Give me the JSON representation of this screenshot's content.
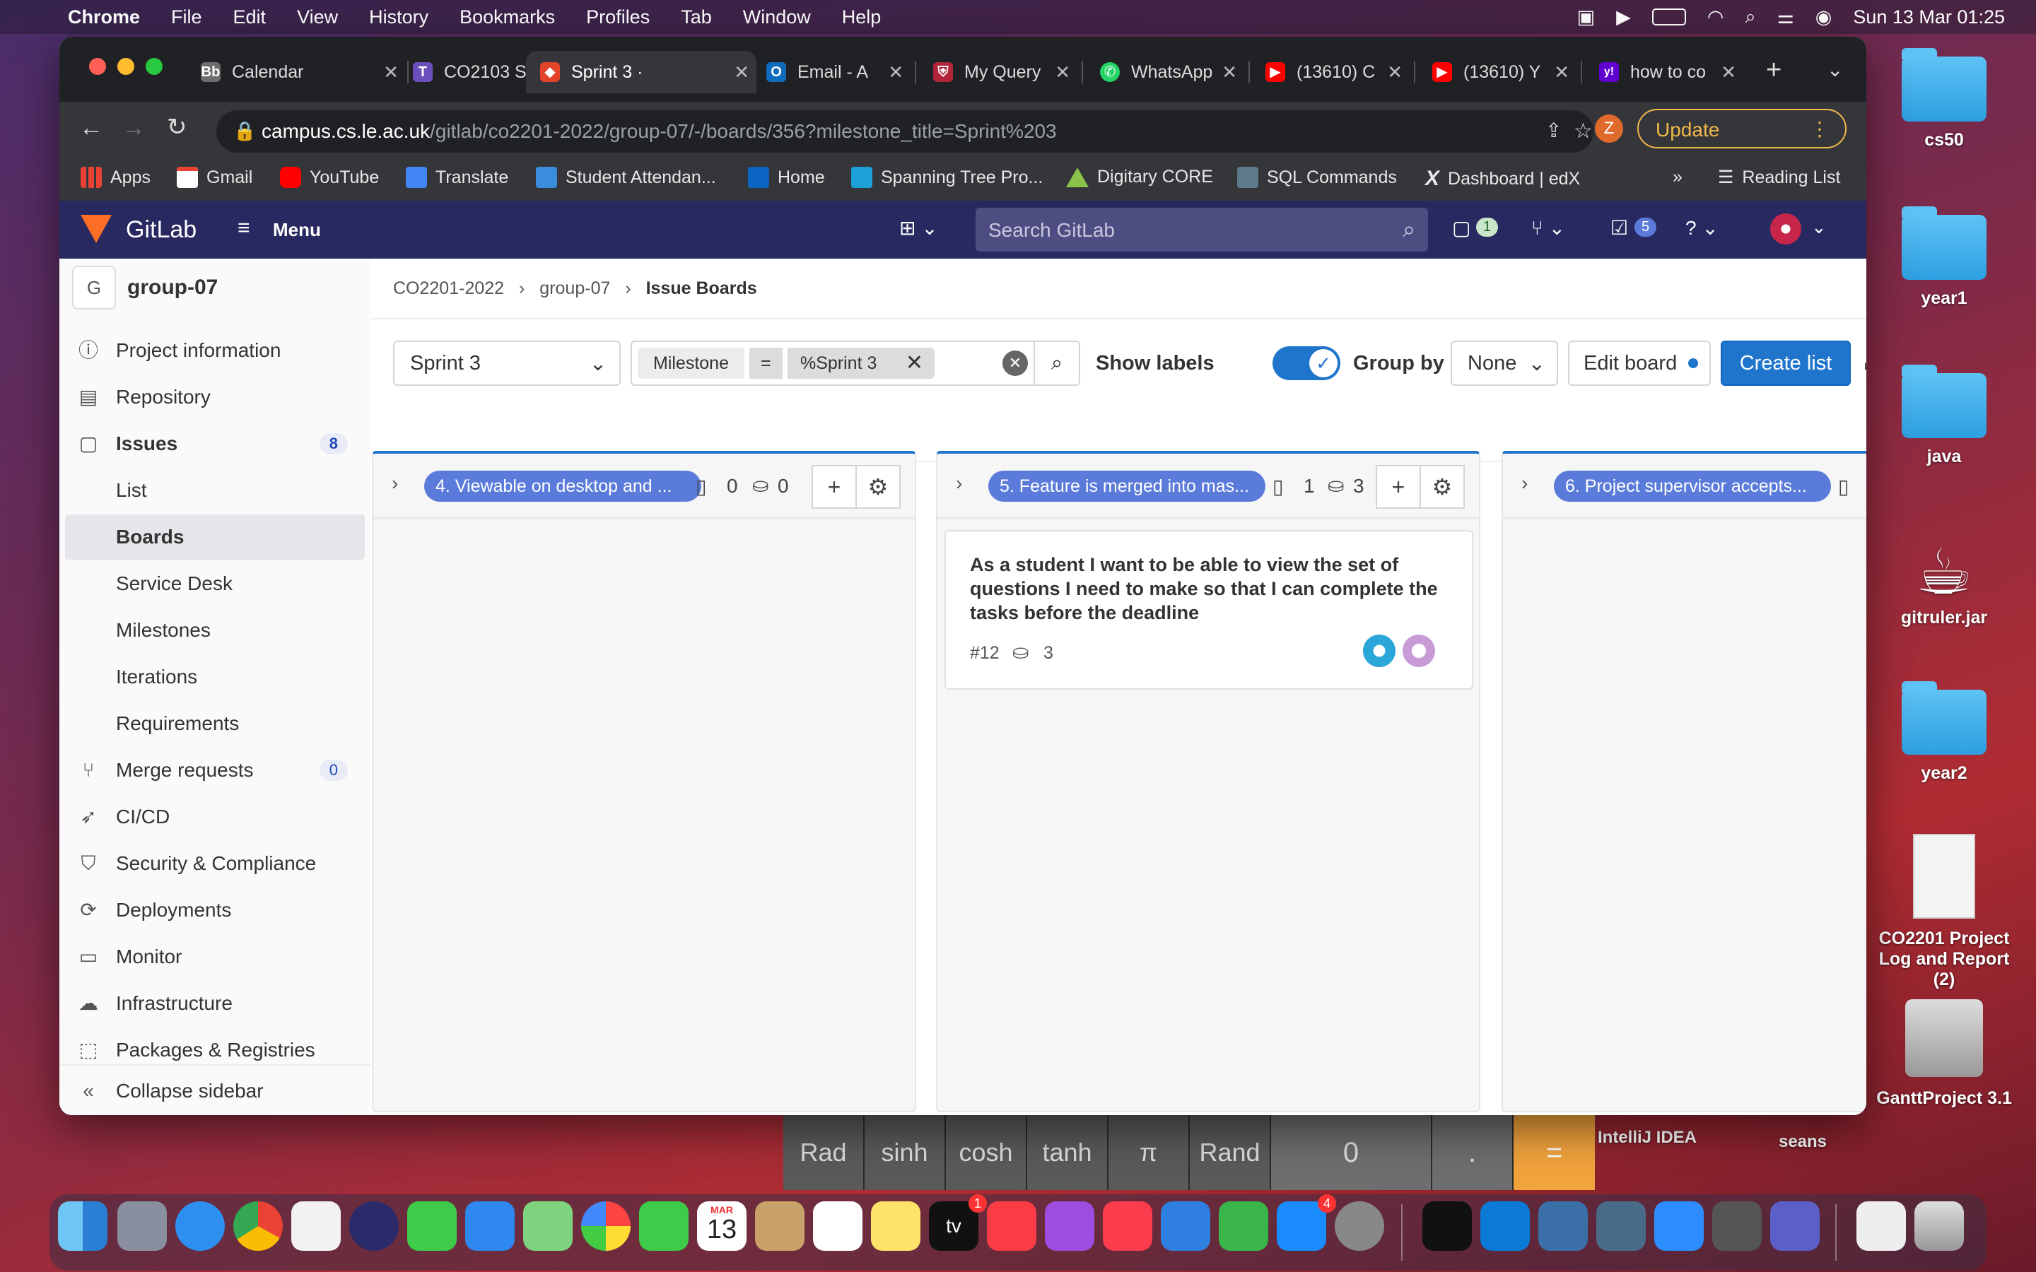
{
  "menubar": {
    "app": "Chrome",
    "items": [
      "File",
      "Edit",
      "View",
      "History",
      "Bookmarks",
      "Profiles",
      "Tab",
      "Window",
      "Help"
    ],
    "datetime": "Sun 13 Mar  01:25"
  },
  "tabs": [
    {
      "label": "Calendar",
      "color": "#6d6d6d",
      "glyph": "Bb"
    },
    {
      "label": "CO2103 S",
      "color": "#6b4fbb",
      "glyph": "T"
    },
    {
      "label": "Sprint 3 ·",
      "color": "#e24329",
      "glyph": "◆"
    },
    {
      "label": "Email - A",
      "color": "#0f6cbd",
      "glyph": "O"
    },
    {
      "label": "My Query",
      "color": "#b1253b",
      "glyph": "⛨"
    },
    {
      "label": "WhatsApp",
      "color": "#25d366",
      "glyph": "✆"
    },
    {
      "label": "(13610) C",
      "color": "#ff0000",
      "glyph": "▶"
    },
    {
      "label": "(13610) Y",
      "color": "#ff0000",
      "glyph": "▶"
    },
    {
      "label": "how to co",
      "color": "#6001d2",
      "glyph": "y!"
    }
  ],
  "address": {
    "host": "campus.cs.le.ac.uk",
    "path": "/gitlab/co2201-2022/group-07/-/boards/356?milestone_title=Sprint%203",
    "update_label": "Update",
    "profile_initial": "Z"
  },
  "bookmarks": [
    "Apps",
    "Gmail",
    "YouTube",
    "Translate",
    "Student Attendan...",
    "Home",
    "Spanning Tree Pro...",
    "Digitary CORE",
    "SQL Commands",
    "Dashboard | edX"
  ],
  "bookmarks_more": "»",
  "reading_list": "Reading List",
  "gitlab": {
    "brand": "GitLab",
    "menu": "Menu",
    "search_placeholder": "Search GitLab",
    "issues_count": "1",
    "todos_count": "5"
  },
  "sidebar": {
    "group_initial": "G",
    "group_name": "group-07",
    "items": [
      {
        "label": "Project information",
        "icon": "info-icon"
      },
      {
        "label": "Repository",
        "icon": "doc-icon"
      },
      {
        "label": "Issues",
        "icon": "issues-icon",
        "badge": "8",
        "bold": true
      },
      {
        "label": "List",
        "sub": true
      },
      {
        "label": "Boards",
        "sub": true,
        "active": true
      },
      {
        "label": "Service Desk",
        "sub": true
      },
      {
        "label": "Milestones",
        "sub": true
      },
      {
        "label": "Iterations",
        "sub": true
      },
      {
        "label": "Requirements",
        "sub": true
      },
      {
        "label": "Merge requests",
        "icon": "merge-icon",
        "badge": "0"
      },
      {
        "label": "CI/CD",
        "icon": "rocket-icon"
      },
      {
        "label": "Security & Compliance",
        "icon": "shield-icon"
      },
      {
        "label": "Deployments",
        "icon": "deploy-icon"
      },
      {
        "label": "Monitor",
        "icon": "monitor-icon"
      },
      {
        "label": "Infrastructure",
        "icon": "cloud-icon"
      },
      {
        "label": "Packages & Registries",
        "icon": "package-icon"
      }
    ],
    "collapse": "Collapse sidebar"
  },
  "breadcrumb": [
    "CO2201-2022",
    "group-07",
    "Issue Boards"
  ],
  "filters": {
    "board_select": "Sprint 3",
    "token_key": "Milestone",
    "token_op": "=",
    "token_value": "%Sprint 3",
    "show_labels": "Show labels",
    "group_by": "Group by",
    "group_value": "None",
    "edit_board": "Edit board",
    "create_list": "Create list"
  },
  "lists": [
    {
      "title": "4. Viewable on desktop and ...",
      "issues": "0",
      "weight": "0"
    },
    {
      "title": "5. Feature is merged into mas...",
      "issues": "1",
      "weight": "3",
      "card": {
        "title": "As a student I want to be able to view the set of questions I need to make so that I can complete the tasks before the deadline",
        "ref": "#12",
        "weight": "3"
      }
    },
    {
      "title": "6. Project supervisor accepts...",
      "issues": "",
      "weight": ""
    }
  ],
  "desktop": [
    "cs50",
    "year1",
    "java",
    "gitruler.jar",
    "year2",
    "CO2201 Project Log and Report (2)",
    "GanttProject 3.1",
    "IntelliJ IDEA",
    "seans"
  ],
  "desktop_partial": [
    "g",
    "ov"
  ],
  "calculator": {
    "keys": [
      "Rad",
      "sinh",
      "cosh",
      "tanh",
      "π",
      "Rand",
      "0",
      ".",
      "="
    ]
  },
  "dock": {
    "calendar_month": "MAR",
    "calendar_day": "13",
    "tv_label": "tv",
    "mail_badge": "1",
    "appstore_badge": "4"
  }
}
